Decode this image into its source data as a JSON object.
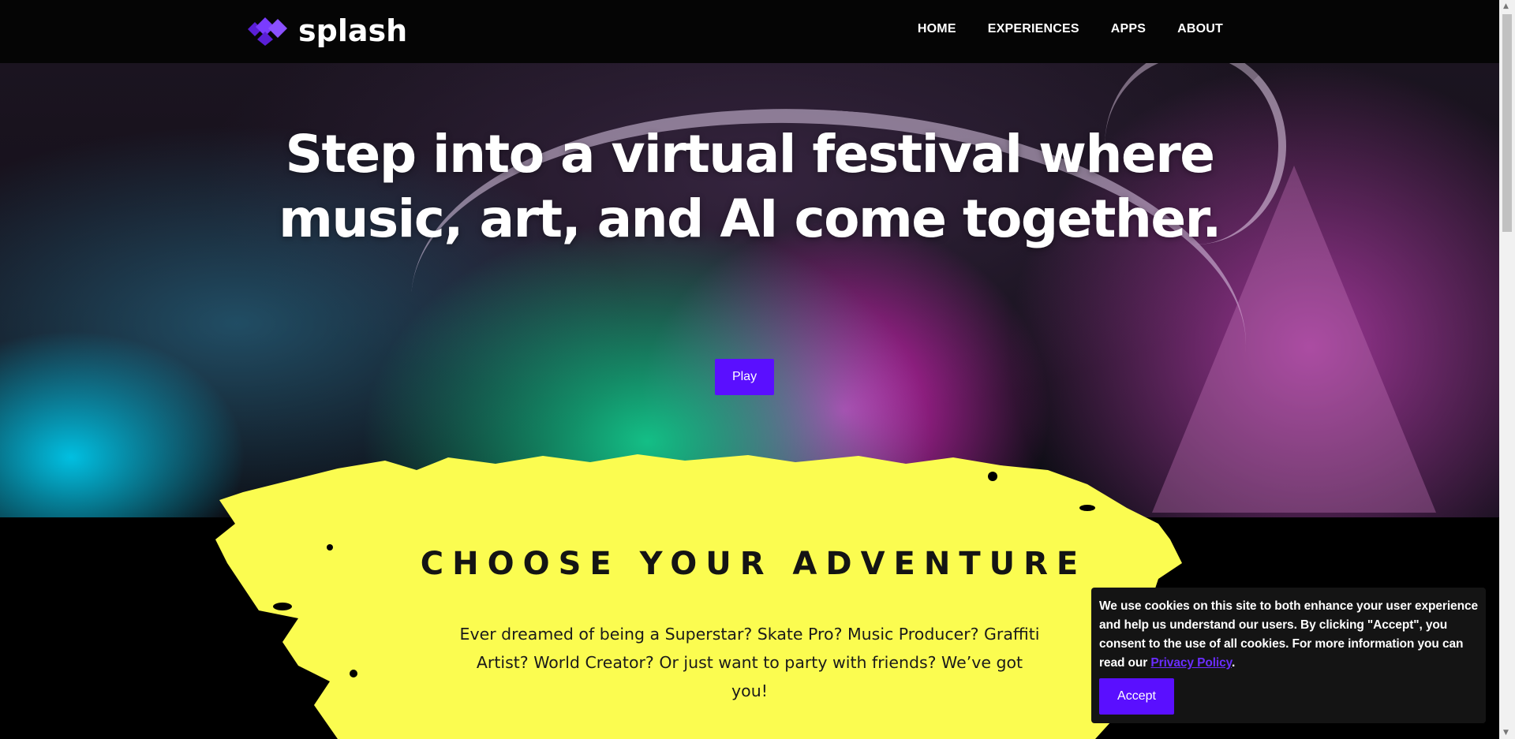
{
  "header": {
    "logo_text": "splash",
    "logo_icon": "diamond-logo-icon",
    "nav": [
      {
        "label": "HOME"
      },
      {
        "label": "EXPERIENCES"
      },
      {
        "label": "APPS"
      },
      {
        "label": "ABOUT"
      }
    ]
  },
  "hero": {
    "title": "Step into a virtual festival where music, art, and AI come together.",
    "play_label": "Play"
  },
  "adventure": {
    "title": "CHOOSE YOUR ADVENTURE",
    "description": "Ever dreamed of being a Superstar? Skate Pro? Music Producer? Graffiti Artist? World Creator? Or just want to party with friends? We’ve got you!"
  },
  "cookie": {
    "text_before": "We use cookies on this site to both enhance your user experience and help us understand our users. By clicking \"Accept\", you consent to the use of all cookies. For more information you can read our ",
    "link_label": "Privacy Policy",
    "text_after": ".",
    "accept_label": "Accept"
  },
  "colors": {
    "accent": "#5a0fff",
    "splash_yellow": "#fbfc50",
    "nav_bg": "#050505",
    "cookie_bg": "#141414"
  }
}
